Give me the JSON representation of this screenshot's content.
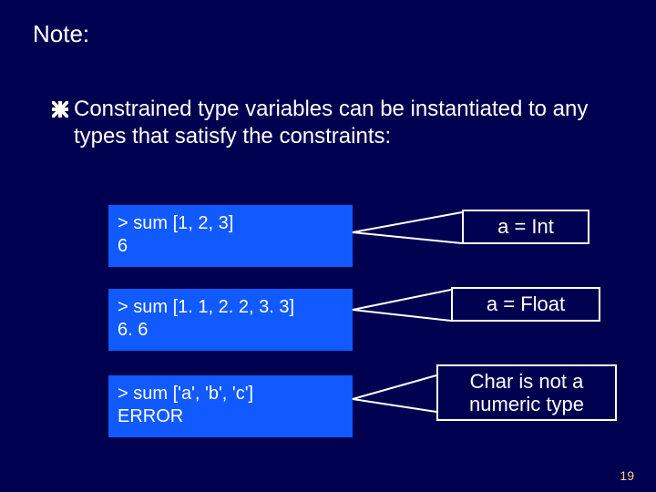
{
  "title": "Note:",
  "bullet": "Constrained type variables can be instantiated to any types that satisfy the constraints:",
  "examples": [
    {
      "input": "> sum [1, 2, 3]",
      "output": "6",
      "annotation": "a = Int"
    },
    {
      "input": "> sum [1. 1, 2. 2, 3. 3]",
      "output": "6. 6",
      "annotation": "a = Float"
    },
    {
      "input": "> sum ['a', 'b', 'c']",
      "output": "ERROR",
      "annotation": "Char is not a numeric type"
    }
  ],
  "page_number": "19"
}
